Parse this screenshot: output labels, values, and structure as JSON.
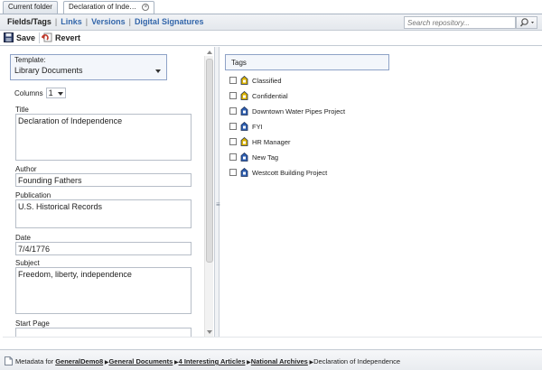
{
  "tabs": [
    {
      "label": "Current folder"
    },
    {
      "label": "Declaration of Inde…"
    }
  ],
  "nav": {
    "fields_tags": "Fields/Tags",
    "links": "Links",
    "versions": "Versions",
    "digital_signatures": "Digital Signatures",
    "separator": "|"
  },
  "search": {
    "placeholder": "Search repository..."
  },
  "toolbar": {
    "save_label": "Save",
    "revert_label": "Revert"
  },
  "template": {
    "label": "Template:",
    "value": "Library Documents"
  },
  "columns": {
    "label": "Columns",
    "value": "1"
  },
  "fields": {
    "title": {
      "label": "Title",
      "value": "Declaration of Independence"
    },
    "author": {
      "label": "Author",
      "value": "Founding Fathers"
    },
    "publication": {
      "label": "Publication",
      "value": "U.S. Historical Records"
    },
    "date": {
      "label": "Date",
      "value": "7/4/1776"
    },
    "subject": {
      "label": "Subject",
      "value": "Freedom, liberty, independence"
    },
    "start_page": {
      "label": "Start Page",
      "value": ""
    }
  },
  "tags": {
    "header": "Tags",
    "items": [
      {
        "label": "Classified",
        "icon": "lock-tag-icon"
      },
      {
        "label": "Confidential",
        "icon": "lock-tag-icon"
      },
      {
        "label": "Downtown Water Pipes Project",
        "icon": "tag-icon"
      },
      {
        "label": "FYI",
        "icon": "tag-icon"
      },
      {
        "label": "HR Manager",
        "icon": "lock-tag-icon"
      },
      {
        "label": "New Tag",
        "icon": "tag-icon"
      },
      {
        "label": "Westcott Building Project",
        "icon": "tag-icon"
      }
    ]
  },
  "status": {
    "prefix": "Metadata for",
    "crumbs": [
      "GeneralDemo8",
      "General Documents",
      "4 Interesting Articles",
      "National Archives"
    ],
    "current": "Declaration of Independence"
  },
  "colors": {
    "accent_link": "#3366aa",
    "tag_lock": "#d8b000",
    "tag_blue": "#2f5fb0"
  }
}
